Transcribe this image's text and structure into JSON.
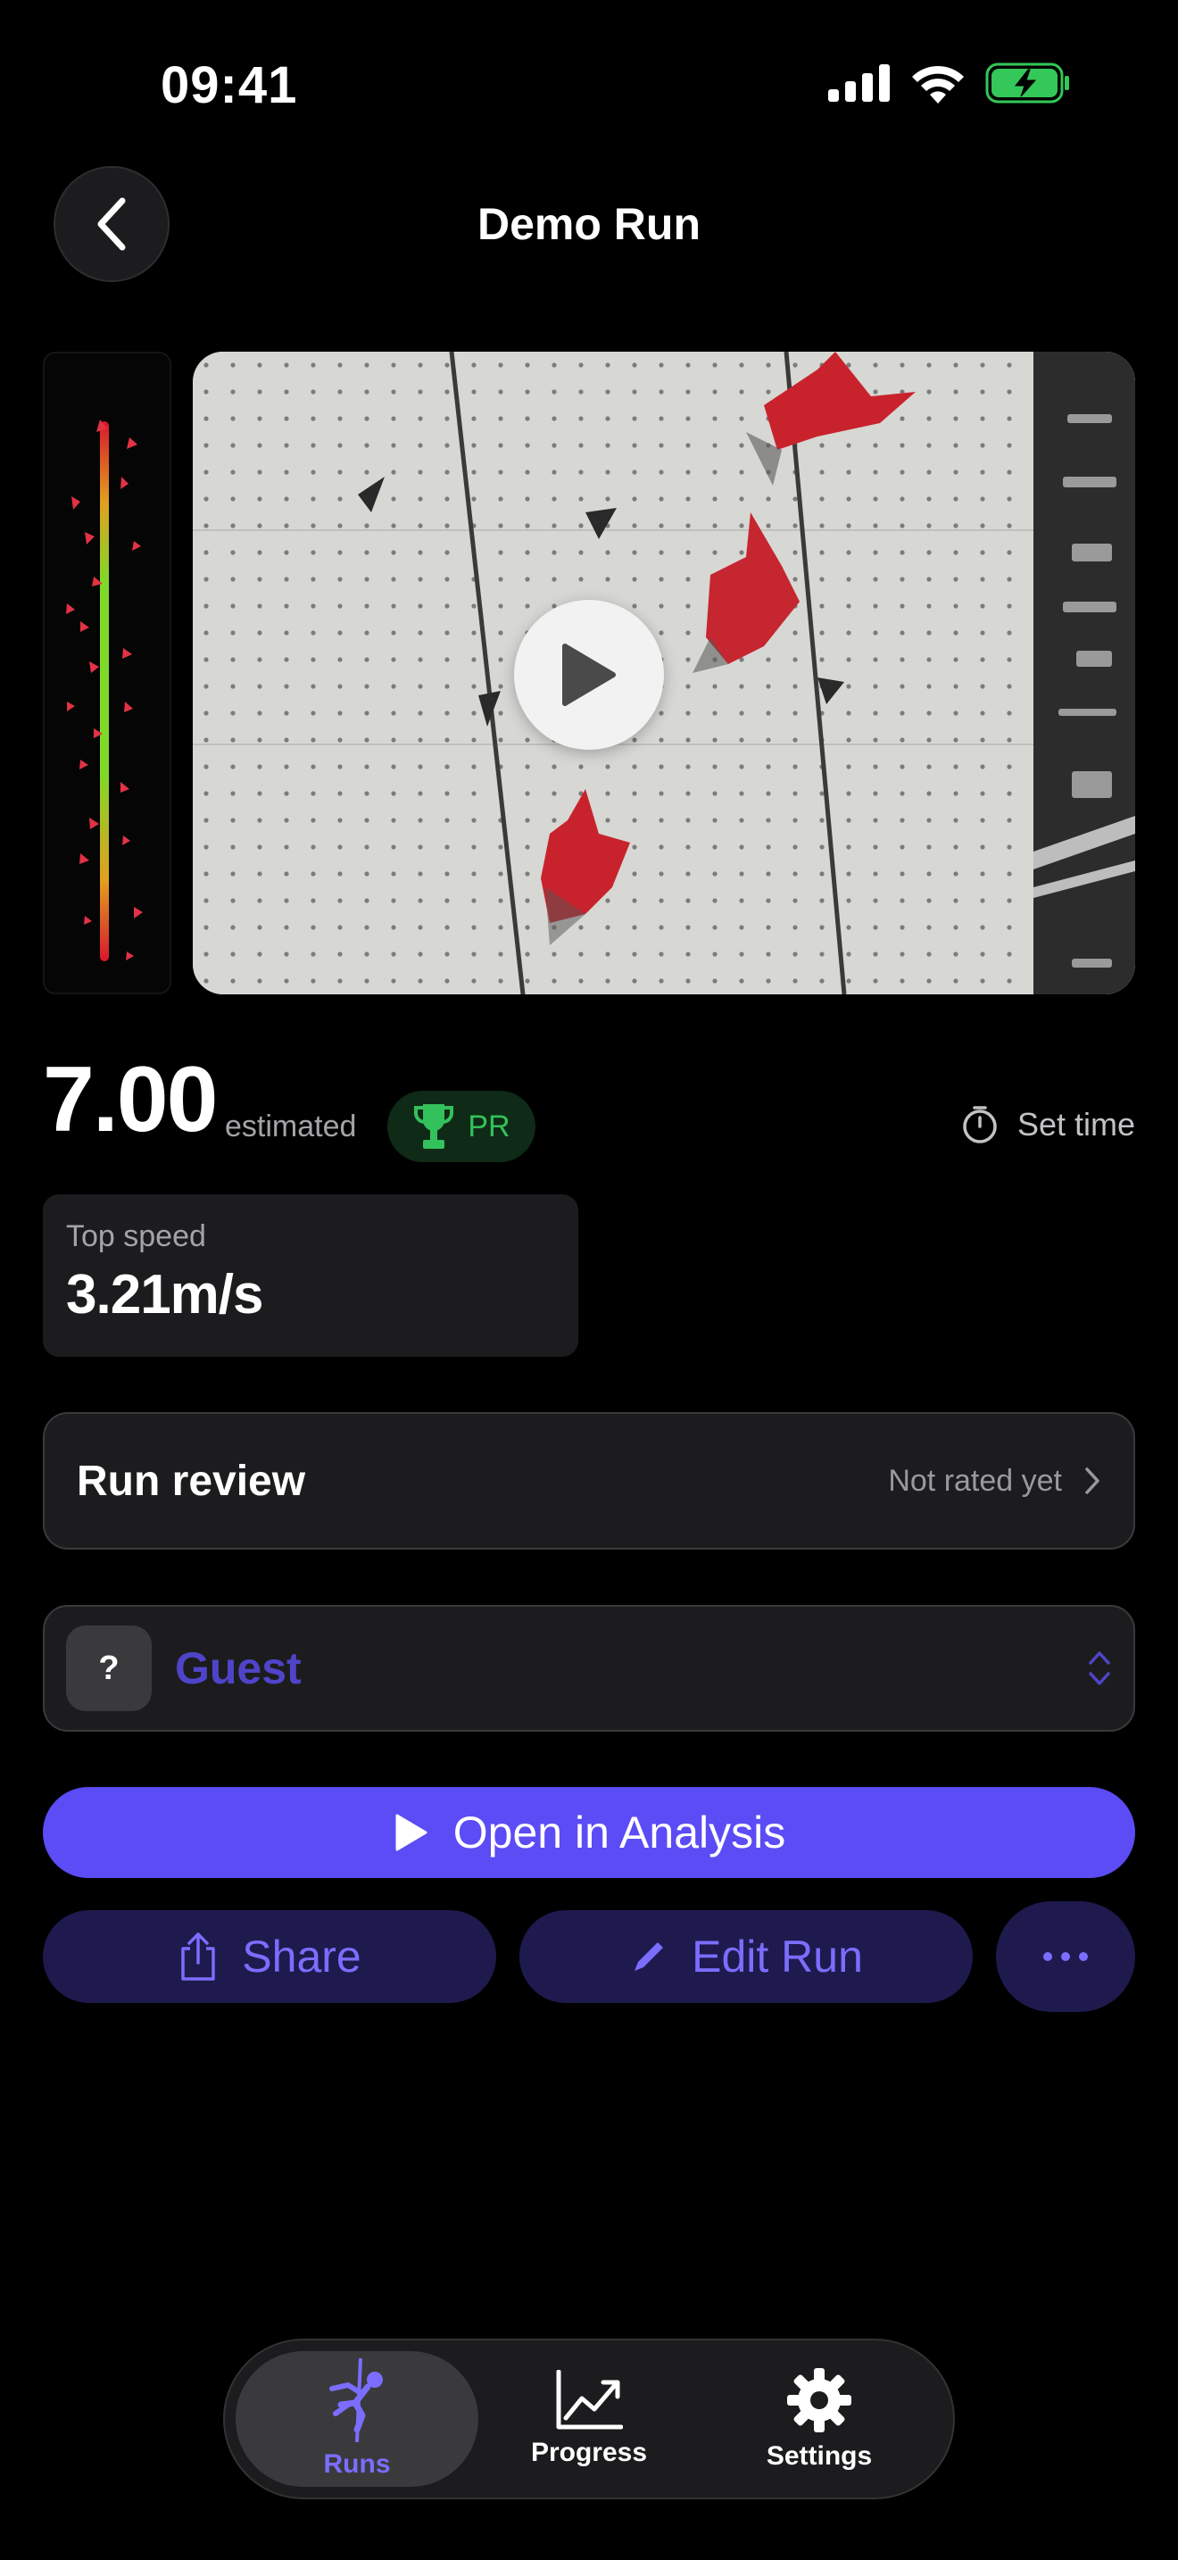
{
  "status_bar": {
    "time": "09:41"
  },
  "header": {
    "title": "Demo Run"
  },
  "video": {
    "play_icon": "play-icon"
  },
  "run": {
    "time": "7.00",
    "time_qualifier": "estimated",
    "badge": "PR",
    "set_time_label": "Set time"
  },
  "stats": {
    "top_speed_label": "Top speed",
    "top_speed_value": "3.21m/s"
  },
  "review": {
    "title": "Run review",
    "status": "Not rated yet"
  },
  "climber": {
    "avatar": "?",
    "name": "Guest"
  },
  "actions": {
    "open_analysis": "Open in Analysis",
    "share": "Share",
    "edit_run": "Edit Run"
  },
  "tabs": [
    {
      "label": "Runs",
      "icon": "climber-icon"
    },
    {
      "label": "Progress",
      "icon": "chart-icon"
    },
    {
      "label": "Settings",
      "icon": "gear-icon"
    }
  ],
  "colors": {
    "accent": "#5b4cf5",
    "accent_text": "#7b6dff",
    "pr_green": "#33c15b",
    "battery_green": "#34c759"
  }
}
